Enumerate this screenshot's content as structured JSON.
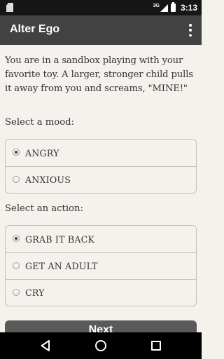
{
  "status_bar": {
    "network": "3G",
    "time": "3:13",
    "icons": [
      "sd-card-icon",
      "signal-icon",
      "battery-icon"
    ]
  },
  "app_bar": {
    "title": "Alter Ego",
    "menu_icon": "overflow-menu-icon"
  },
  "scenario": {
    "text": "You are in a sandbox playing with your favorite toy. A larger, stronger child pulls it away from you and screams, \"MINE!\""
  },
  "mood": {
    "label": "Select a mood:",
    "options": [
      {
        "label": "ANGRY",
        "selected": true
      },
      {
        "label": "ANXIOUS",
        "selected": false
      }
    ]
  },
  "action": {
    "label": "Select an action:",
    "options": [
      {
        "label": "GRAB IT BACK",
        "selected": true
      },
      {
        "label": "GET AN ADULT",
        "selected": false
      },
      {
        "label": "CRY",
        "selected": false
      }
    ]
  },
  "next_button": {
    "label": "Next"
  },
  "nav_bar": {
    "icons": [
      "back-icon",
      "home-icon",
      "recents-icon"
    ]
  }
}
